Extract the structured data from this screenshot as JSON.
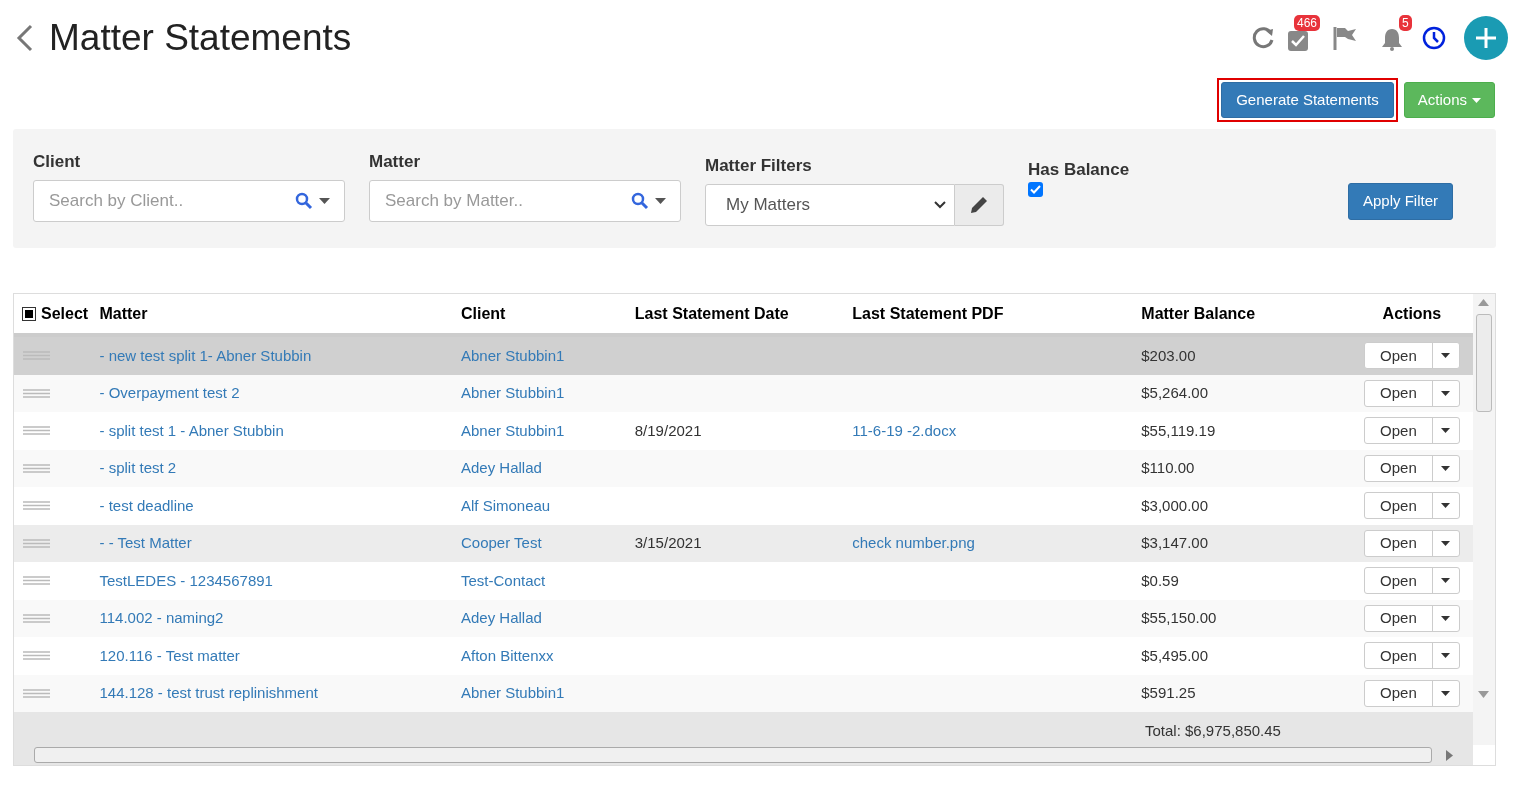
{
  "header": {
    "title": "Matter Statements",
    "task_count": "466",
    "notification_count": "5"
  },
  "toolbar": {
    "generate_button": {
      "label": "Generate Statements",
      "highlighted": true
    },
    "actions_button": {
      "label": "Actions"
    }
  },
  "filters": {
    "client": {
      "label": "Client",
      "placeholder": "Search by Client.."
    },
    "matter": {
      "label": "Matter",
      "placeholder": "Search by Matter.."
    },
    "matter_filters": {
      "label": "Matter Filters",
      "value": "My Matters"
    },
    "has_balance": {
      "label": "Has Balance",
      "checked": true
    },
    "apply_button": "Apply Filter"
  },
  "table": {
    "select_all": {
      "indeterminate": true
    },
    "columns": [
      "Select",
      "Matter",
      "Client",
      "Last Statement Date",
      "Last Statement PDF",
      "Matter Balance",
      "Actions"
    ],
    "rows": [
      {
        "matter": "- new test split 1- Abner Stubbin",
        "client": "Abner Stubbin1",
        "date": "",
        "pdf": "",
        "balance": "$203.00",
        "action": "Open",
        "selected": true,
        "hovered": false
      },
      {
        "matter": "- Overpayment test 2",
        "client": "Abner Stubbin1",
        "date": "",
        "pdf": "",
        "balance": "$5,264.00",
        "action": "Open",
        "selected": false,
        "hovered": false
      },
      {
        "matter": "- split test 1 - Abner Stubbin",
        "client": "Abner Stubbin1",
        "date": "8/19/2021",
        "pdf": "11-6-19 -2.docx",
        "balance": "$55,119.19",
        "action": "Open",
        "selected": false,
        "hovered": false
      },
      {
        "matter": "- split test 2",
        "client": "Adey Hallad",
        "date": "",
        "pdf": "",
        "balance": "$110.00",
        "action": "Open",
        "selected": false,
        "hovered": false
      },
      {
        "matter": "- test deadline",
        "client": "Alf Simoneau",
        "date": "",
        "pdf": "",
        "balance": "$3,000.00",
        "action": "Open",
        "selected": false,
        "hovered": false
      },
      {
        "matter": "- - Test Matter",
        "client": "Cooper Test",
        "date": "3/15/2021",
        "pdf": "check number.png",
        "balance": "$3,147.00",
        "action": "Open",
        "selected": false,
        "hovered": true
      },
      {
        "matter": "TestLEDES - 1234567891",
        "client": "Test-Contact",
        "date": "",
        "pdf": "",
        "balance": "$0.59",
        "action": "Open",
        "selected": false,
        "hovered": false
      },
      {
        "matter": "114.002 - naming2",
        "client": "Adey Hallad",
        "date": "",
        "pdf": "",
        "balance": "$55,150.00",
        "action": "Open",
        "selected": false,
        "hovered": false
      },
      {
        "matter": "120.116 - Test matter",
        "client": "Afton Bittenxx",
        "date": "",
        "pdf": "",
        "balance": "$5,495.00",
        "action": "Open",
        "selected": false,
        "hovered": false
      },
      {
        "matter": "144.128 - test trust replinishment",
        "client": "Abner Stubbin1",
        "date": "",
        "pdf": "",
        "balance": "$591.25",
        "action": "Open",
        "selected": false,
        "hovered": false
      }
    ],
    "total": "Total: $6,975,850.45"
  }
}
